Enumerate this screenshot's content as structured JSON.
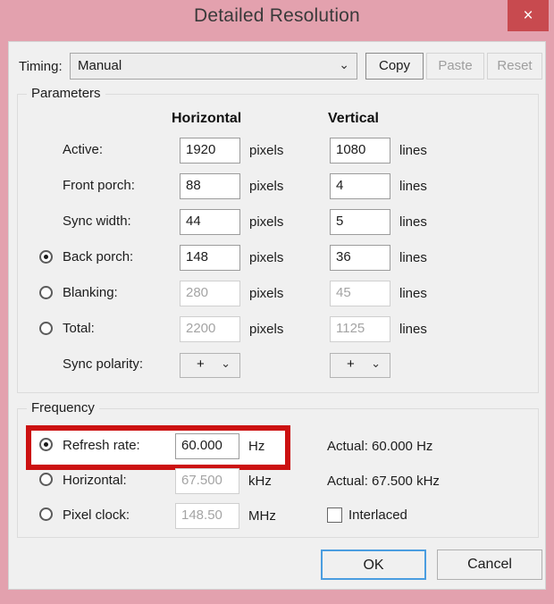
{
  "window": {
    "title": "Detailed Resolution",
    "close_label": "×"
  },
  "timing": {
    "label": "Timing:",
    "selected": "Manual",
    "arrow": "⌄",
    "copy_label": "Copy",
    "paste_label": "Paste",
    "reset_label": "Reset"
  },
  "parameters": {
    "legend": "Parameters",
    "col_horizontal": "Horizontal",
    "col_vertical": "Vertical",
    "unit_pixels": "pixels",
    "unit_lines": "lines",
    "rows": [
      {
        "label": "Active:",
        "h": "1920",
        "v": "1080",
        "hunit": "pixels",
        "vunit": "lines",
        "radio": false,
        "selected": false,
        "disabled": false
      },
      {
        "label": "Front porch:",
        "h": "88",
        "v": "4",
        "hunit": "pixels",
        "vunit": "lines",
        "radio": false,
        "selected": false,
        "disabled": false
      },
      {
        "label": "Sync width:",
        "h": "44",
        "v": "5",
        "hunit": "pixels",
        "vunit": "lines",
        "radio": false,
        "selected": false,
        "disabled": false
      },
      {
        "label": "Back porch:",
        "h": "148",
        "v": "36",
        "hunit": "pixels",
        "vunit": "lines",
        "radio": true,
        "selected": true,
        "disabled": false
      },
      {
        "label": "Blanking:",
        "h": "280",
        "v": "45",
        "hunit": "pixels",
        "vunit": "lines",
        "radio": true,
        "selected": false,
        "disabled": true
      },
      {
        "label": "Total:",
        "h": "2200",
        "v": "1125",
        "hunit": "pixels",
        "vunit": "lines",
        "radio": true,
        "selected": false,
        "disabled": true
      }
    ],
    "sync_polarity": {
      "label": "Sync polarity:",
      "horizontal_value": "+",
      "vertical_value": "+",
      "arrow": "⌄"
    }
  },
  "frequency": {
    "legend": "Frequency",
    "rows": [
      {
        "label": "Refresh rate:",
        "value": "60.000",
        "unit": "Hz",
        "selected": true,
        "disabled": false,
        "actual": "Actual: 60.000 Hz"
      },
      {
        "label": "Horizontal:",
        "value": "67.500",
        "unit": "kHz",
        "selected": false,
        "disabled": true,
        "actual": "Actual: 67.500 kHz"
      },
      {
        "label": "Pixel clock:",
        "value": "148.50",
        "unit": "MHz",
        "selected": false,
        "disabled": true,
        "actual": ""
      }
    ],
    "interlaced_label": "Interlaced",
    "interlaced_checked": false,
    "highlight_color": "#cc1111"
  },
  "footer": {
    "ok_label": "OK",
    "cancel_label": "Cancel"
  },
  "colors": {
    "titlebar": "#e3a1ae",
    "close_button": "#c84a4f",
    "client": "#f0f0f0",
    "accent_focus": "#4a9de0",
    "highlight": "#cc1111"
  }
}
